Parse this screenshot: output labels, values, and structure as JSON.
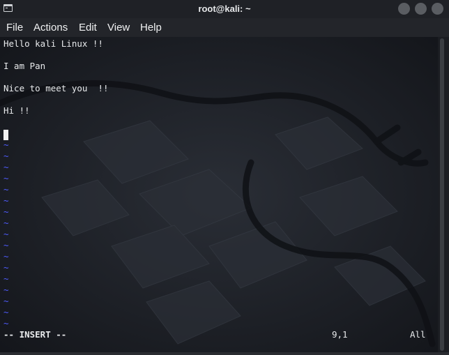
{
  "window": {
    "title": "root@kali: ~"
  },
  "menu": {
    "items": [
      "File",
      "Actions",
      "Edit",
      "View",
      "Help"
    ]
  },
  "buffer": {
    "lines": [
      "Hello kali Linux !!",
      "",
      "I am Pan",
      "",
      "Nice to meet you  !!",
      "",
      "Hi !!",
      ""
    ],
    "empty_line_marker": "~"
  },
  "status": {
    "mode": "-- INSERT --",
    "position": "9,1",
    "scroll": "All"
  },
  "colors": {
    "tilde": "#4f5cff",
    "text": "#e8eaec",
    "background": "#15171c"
  }
}
